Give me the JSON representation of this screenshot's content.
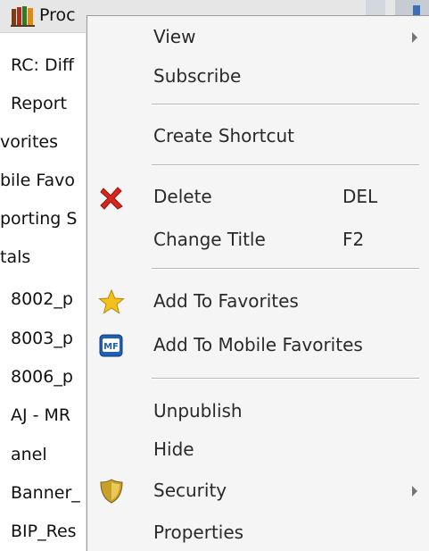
{
  "tree": {
    "root_label": "Proc",
    "items": [
      {
        "label": "RC: Diff"
      },
      {
        "label": "Report"
      },
      {
        "label": "vorites"
      },
      {
        "label": "bile Favo"
      },
      {
        "label": "porting S"
      },
      {
        "label": "tals"
      },
      {
        "label": "8002_p"
      },
      {
        "label": "8003_p"
      },
      {
        "label": "8006_p"
      },
      {
        "label": "AJ - MR"
      },
      {
        "label": "anel"
      },
      {
        "label": "Banner_"
      },
      {
        "label": "BIP_Res"
      }
    ]
  },
  "menu": {
    "items": [
      {
        "label": "View",
        "has_submenu": true
      },
      {
        "label": "Subscribe"
      },
      {
        "label": "Create Shortcut"
      },
      {
        "label": "Delete",
        "shortcut": "DEL",
        "icon": "delete-x-icon"
      },
      {
        "label": "Change Title",
        "shortcut": "F2"
      },
      {
        "label": "Add To Favorites",
        "icon": "star-icon"
      },
      {
        "label": "Add To Mobile Favorites",
        "icon": "mobile-favorites-mf-icon"
      },
      {
        "label": "Unpublish"
      },
      {
        "label": "Hide"
      },
      {
        "label": "Security",
        "has_submenu": true,
        "icon": "shield-icon"
      },
      {
        "label": "Properties"
      }
    ]
  },
  "colors": {
    "menu_background": "#f5f5f5",
    "delete_icon": "#d9261c",
    "star_icon": "#f2c21b",
    "mf_icon": "#1f5fb4"
  }
}
